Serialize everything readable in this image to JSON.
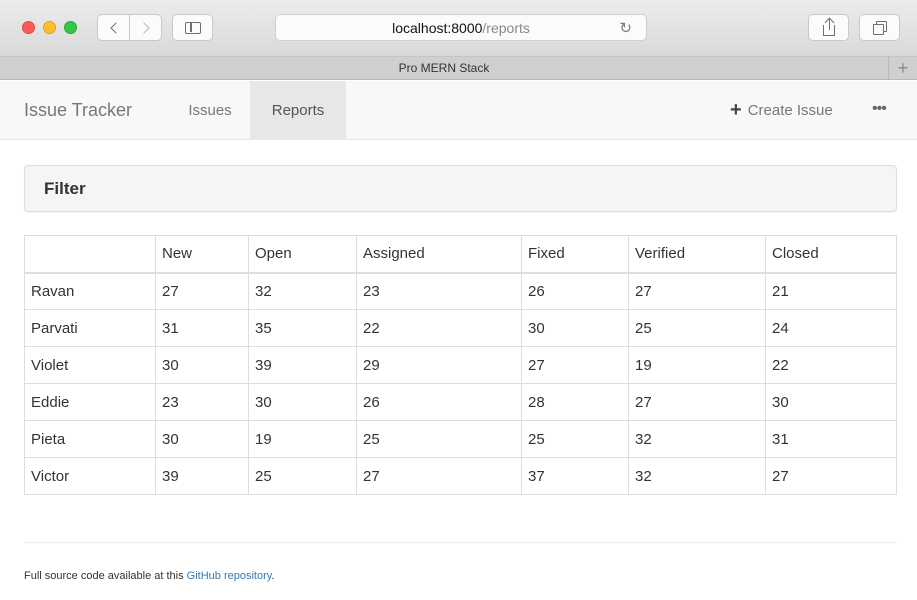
{
  "browser": {
    "url_host": "localhost:8000",
    "url_path": "/reports",
    "tab_title": "Pro MERN Stack"
  },
  "navbar": {
    "brand": "Issue Tracker",
    "items": [
      {
        "label": "Issues",
        "active": false
      },
      {
        "label": "Reports",
        "active": true
      }
    ],
    "create_issue": "Create Issue",
    "more": "•••"
  },
  "filter": {
    "title": "Filter"
  },
  "report_table": {
    "headers": [
      "",
      "New",
      "Open",
      "Assigned",
      "Fixed",
      "Verified",
      "Closed"
    ],
    "rows": [
      {
        "owner": "Ravan",
        "values": [
          "27",
          "32",
          "23",
          "26",
          "27",
          "21"
        ]
      },
      {
        "owner": "Parvati",
        "values": [
          "31",
          "35",
          "22",
          "30",
          "25",
          "24"
        ]
      },
      {
        "owner": "Violet",
        "values": [
          "30",
          "39",
          "29",
          "27",
          "19",
          "22"
        ]
      },
      {
        "owner": "Eddie",
        "values": [
          "23",
          "30",
          "26",
          "28",
          "27",
          "30"
        ]
      },
      {
        "owner": "Pieta",
        "values": [
          "30",
          "19",
          "25",
          "25",
          "32",
          "31"
        ]
      },
      {
        "owner": "Victor",
        "values": [
          "39",
          "25",
          "27",
          "37",
          "32",
          "27"
        ]
      }
    ]
  },
  "footer": {
    "text": "Full source code available at this",
    "link_text": "GitHub repository",
    "end": "."
  },
  "colors": {
    "link": "#337ab7",
    "navbar_bg": "#f8f8f8",
    "active_nav_bg": "#e7e7e7"
  }
}
